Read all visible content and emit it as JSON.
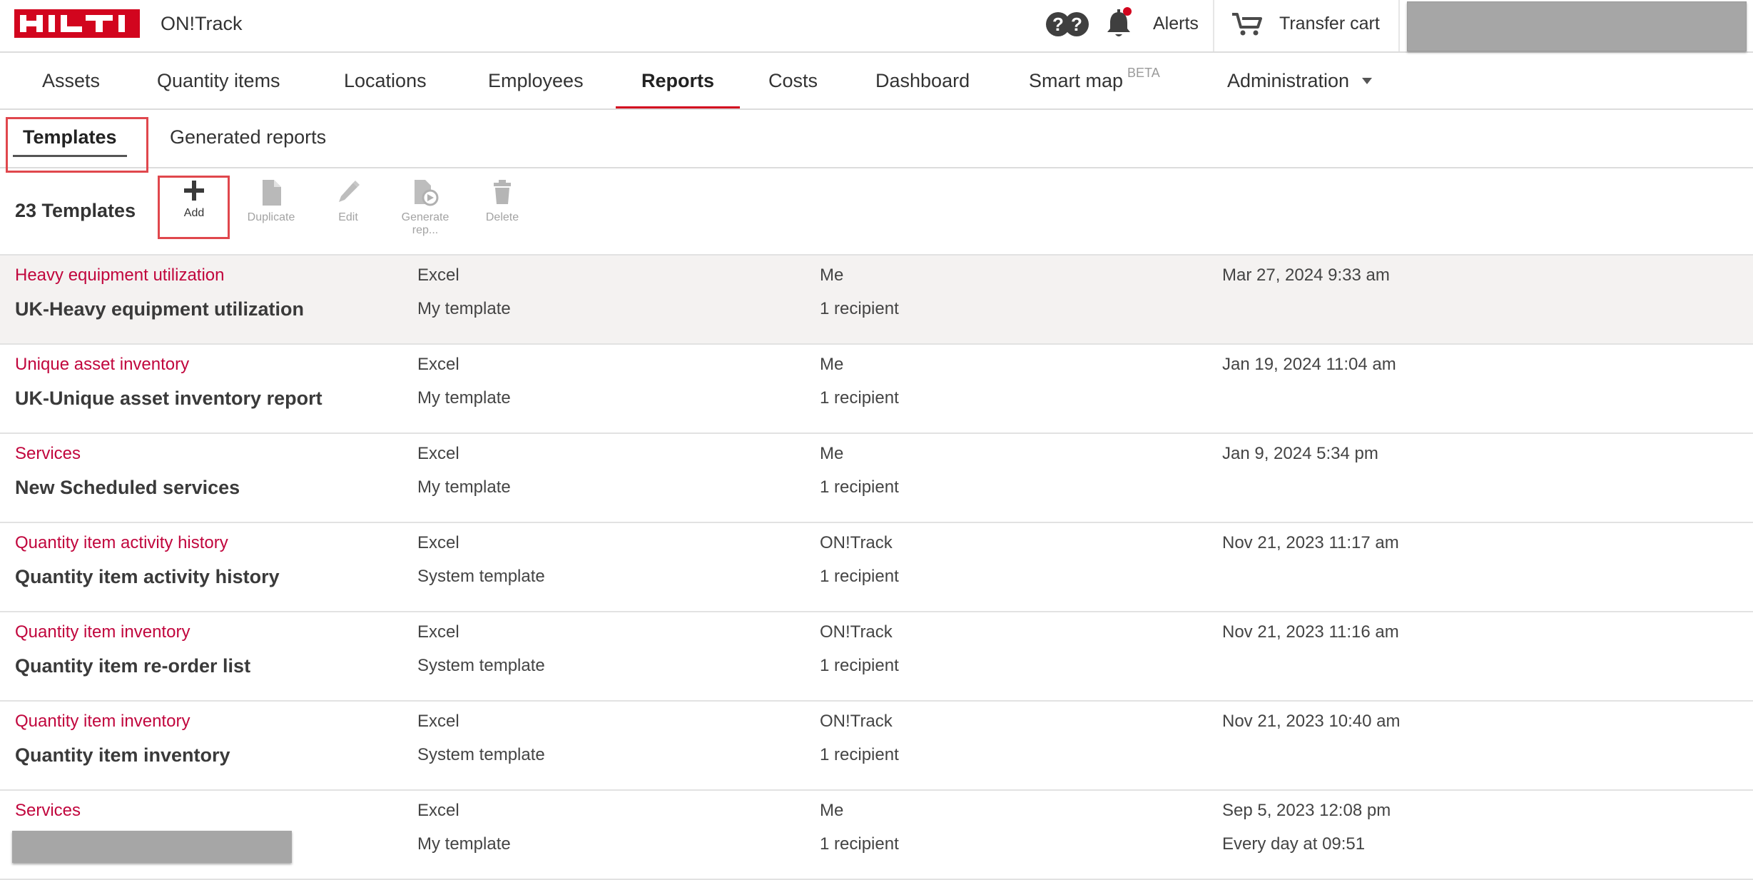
{
  "header": {
    "brand_logo_text": "HILTI",
    "app_name": "ON!Track",
    "help_icon": "help-icon",
    "bell_icon": "bell-icon",
    "alerts_label": "Alerts",
    "cart_icon": "cart-icon",
    "transfer_cart_label": "Transfer cart",
    "brand_color": "#d2051e"
  },
  "nav": {
    "items": [
      {
        "label": "Assets"
      },
      {
        "label": "Quantity items"
      },
      {
        "label": "Locations"
      },
      {
        "label": "Employees"
      },
      {
        "label": "Reports",
        "active": true
      },
      {
        "label": "Costs"
      },
      {
        "label": "Dashboard"
      },
      {
        "label": "Smart map",
        "badge": "BETA"
      },
      {
        "label": "Administration",
        "has_dropdown": true
      }
    ]
  },
  "subtabs": {
    "templates": "Templates",
    "generated_reports": "Generated reports"
  },
  "toolbar": {
    "count_label": "23 Templates",
    "add": "Add",
    "duplicate": "Duplicate",
    "edit": "Edit",
    "generate_line1": "Generate",
    "generate_line2": "rep...",
    "delete": "Delete"
  },
  "templates": [
    {
      "type": "Heavy equipment utilization",
      "name": "UK-Heavy equipment utilization",
      "format": "Excel",
      "kind": "My template",
      "owner": "Me",
      "recipients": "1 recipient",
      "date": "Mar 27, 2024 9:33 am",
      "schedule": "",
      "selected": true
    },
    {
      "type": "Unique asset inventory",
      "name": "UK-Unique asset inventory report",
      "format": "Excel",
      "kind": "My template",
      "owner": "Me",
      "recipients": "1 recipient",
      "date": "Jan 19, 2024 11:04 am",
      "schedule": ""
    },
    {
      "type": "Services",
      "name": "New Scheduled services",
      "format": "Excel",
      "kind": "My template",
      "owner": "Me",
      "recipients": "1 recipient",
      "date": "Jan 9, 2024 5:34 pm",
      "schedule": ""
    },
    {
      "type": "Quantity item activity history",
      "name": "Quantity item activity history",
      "format": "Excel",
      "kind": "System template",
      "owner": "ON!Track",
      "recipients": "1 recipient",
      "date": "Nov 21, 2023 11:17 am",
      "schedule": ""
    },
    {
      "type": "Quantity item inventory",
      "name": "Quantity item re-order list",
      "format": "Excel",
      "kind": "System template",
      "owner": "ON!Track",
      "recipients": "1 recipient",
      "date": "Nov 21, 2023 11:16 am",
      "schedule": ""
    },
    {
      "type": "Quantity item inventory",
      "name": "Quantity item inventory",
      "format": "Excel",
      "kind": "System template",
      "owner": "ON!Track",
      "recipients": "1 recipient",
      "date": "Nov 21, 2023 10:40 am",
      "schedule": ""
    },
    {
      "type": "Services",
      "name": "",
      "format": "Excel",
      "kind": "My template",
      "owner": "Me",
      "recipients": "1 recipient",
      "date": "Sep 5, 2023 12:08 pm",
      "schedule": "Every day at 09:51",
      "name_redacted": true
    }
  ]
}
